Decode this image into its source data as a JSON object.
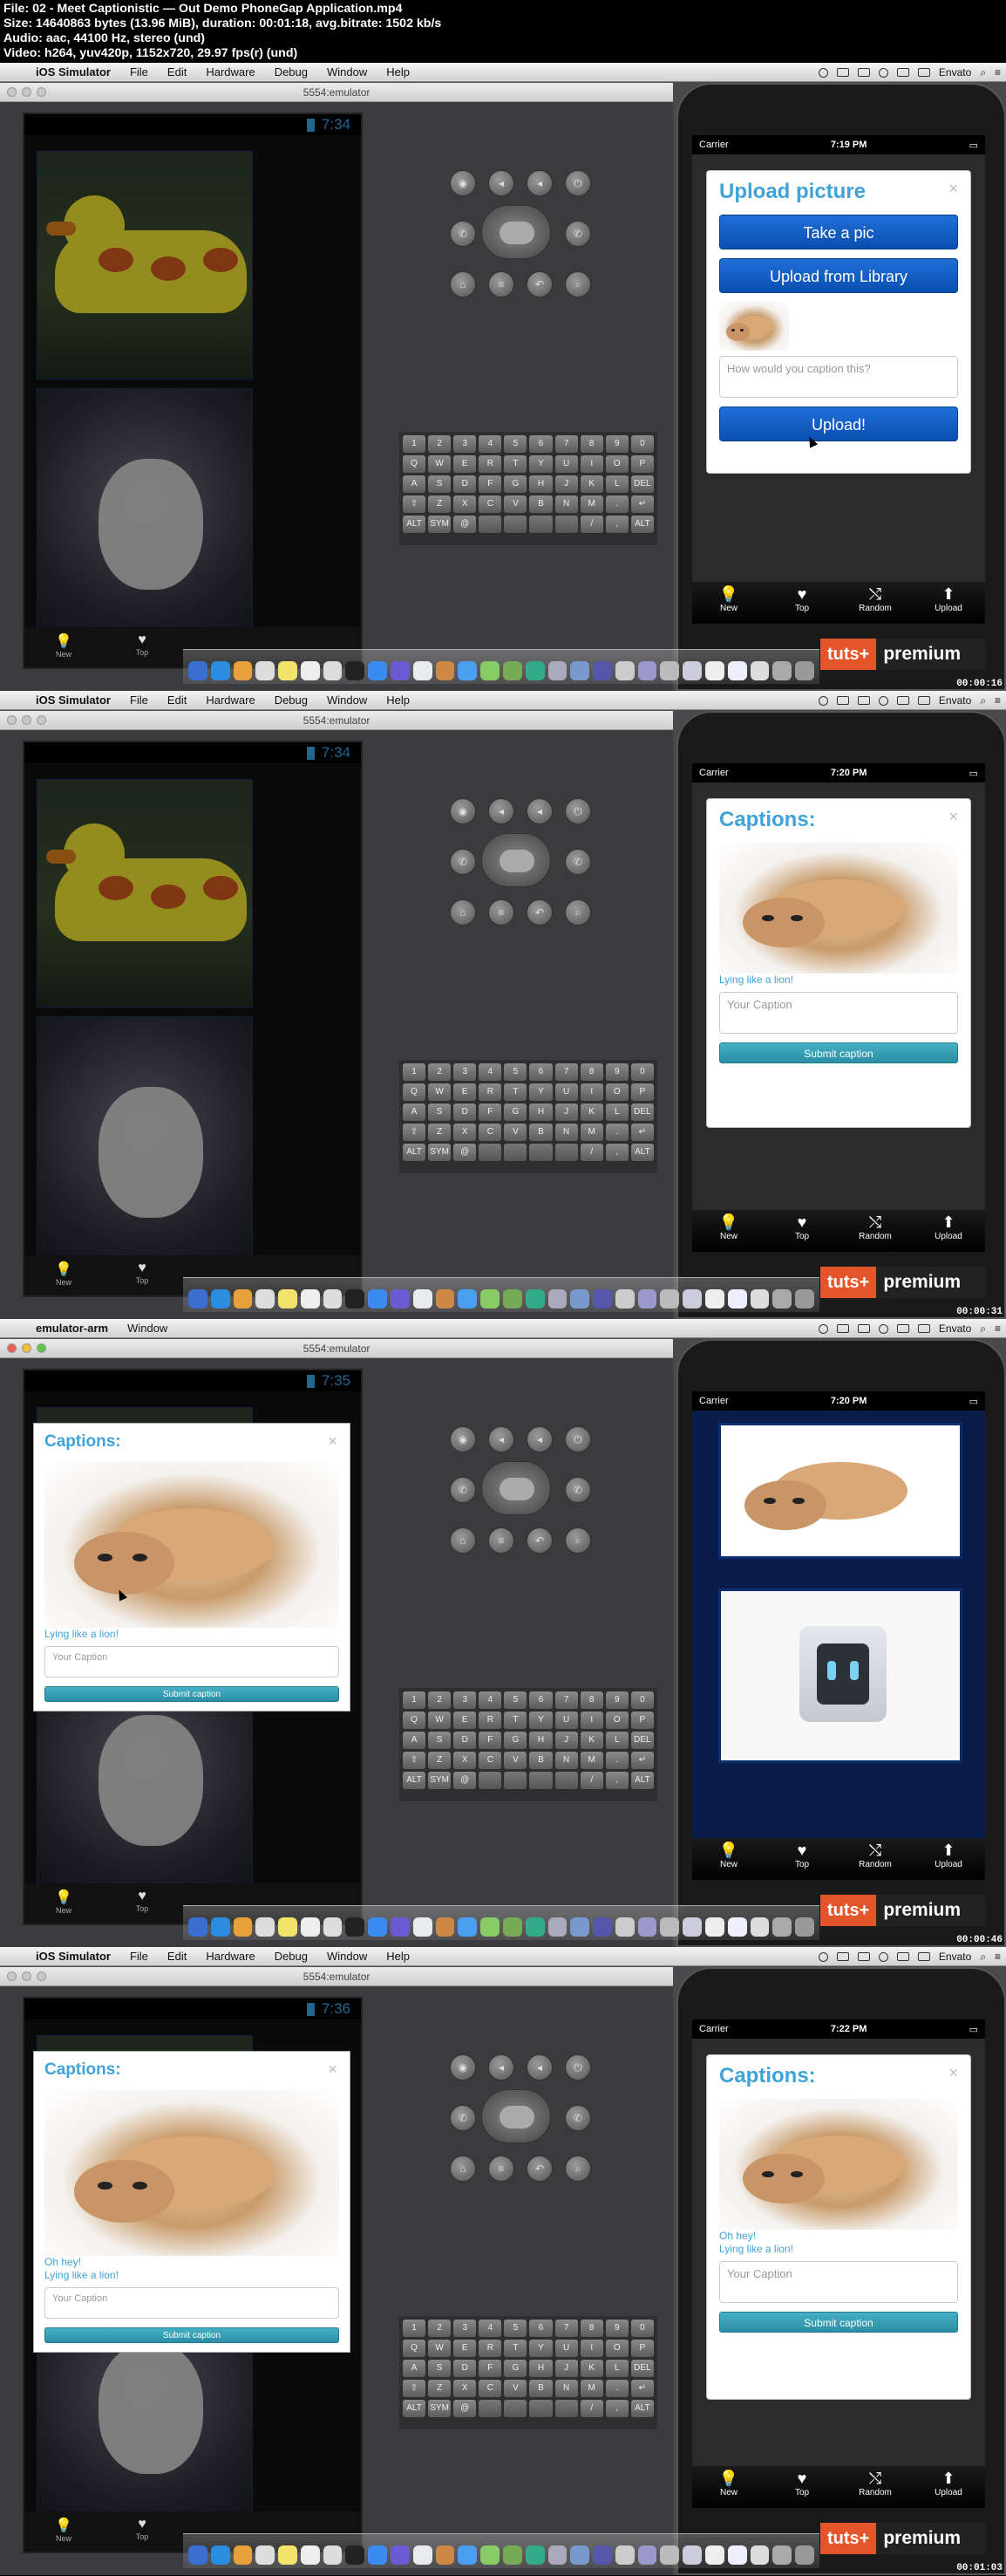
{
  "header": {
    "line1": "File: 02 - Meet Captionistic — Out Demo PhoneGap Application.mp4",
    "line2": "Size: 14640863 bytes (13.96 MiB), duration: 00:01:18, avg.bitrate: 1502 kb/s",
    "line3": "Audio: aac, 44100 Hz, stereo (und)",
    "line4": "Video: h264, yuv420p, 1152x720, 29.97 fps(r) (und)"
  },
  "emulator_window_title": "5554:emulator",
  "menu_items": [
    "File",
    "Edit",
    "Hardware",
    "Debug",
    "Window",
    "Help"
  ],
  "menu_right": "Envato",
  "keyboard_rows": [
    [
      "1",
      "2",
      "3",
      "4",
      "5",
      "6",
      "7",
      "8",
      "9",
      "0"
    ],
    [
      "Q",
      "W",
      "E",
      "R",
      "T",
      "Y",
      "U",
      "I",
      "O",
      "P"
    ],
    [
      "A",
      "S",
      "D",
      "F",
      "G",
      "H",
      "J",
      "K",
      "L",
      "DEL"
    ],
    [
      "⇧",
      "Z",
      "X",
      "C",
      "V",
      "B",
      "N",
      "M",
      ".",
      "↵"
    ],
    [
      "ALT",
      "SYM",
      "@",
      "",
      "",
      "",
      "",
      "/",
      ",",
      "ALT"
    ]
  ],
  "tabs": [
    {
      "label": "New",
      "glyph": "💡"
    },
    {
      "label": "Top",
      "glyph": "♥"
    },
    {
      "label": "Random",
      "glyph": "⤭"
    },
    {
      "label": "Upload",
      "glyph": "⬆"
    }
  ],
  "android_nav": [
    {
      "label": "New"
    },
    {
      "label": "Top"
    }
  ],
  "brand": {
    "tuts": "tuts+",
    "premium": "premium"
  },
  "frames": [
    {
      "app": "iOS Simulator",
      "android_time": "7:34",
      "ios_carrier": "Carrier",
      "ios_time": "7:19 PM",
      "timestamp": "00:00:16",
      "upload_modal": {
        "title": "Upload picture",
        "close": "×",
        "take_pic": "Take a pic",
        "upload_library": "Upload from Library",
        "caption_placeholder": "How would you caption this?",
        "upload_button": "Upload!"
      }
    },
    {
      "app": "iOS Simulator",
      "android_time": "7:34",
      "ios_carrier": "Carrier",
      "ios_time": "7:20 PM",
      "timestamp": "00:00:31",
      "captions_modal": {
        "title": "Captions:",
        "close": "×",
        "captions": [
          "Lying like a lion!"
        ],
        "placeholder": "Your Caption",
        "submit": "Submit caption"
      }
    },
    {
      "app": "emulator-arm",
      "app_menu": "Window",
      "android_time": "7:35",
      "ios_carrier": "Carrier",
      "ios_time": "7:20 PM",
      "timestamp": "00:00:46",
      "android_modal": {
        "title": "Captions:",
        "close": "×",
        "captions": [
          "Lying like a lion!"
        ],
        "placeholder": "Your Caption",
        "submit": "Submit caption"
      }
    },
    {
      "app": "iOS Simulator",
      "android_time": "7:36",
      "ios_carrier": "Carrier",
      "ios_time": "7:22 PM",
      "timestamp": "00:01:03",
      "android_modal": {
        "title": "Captions:",
        "close": "×",
        "captions": [
          "Oh hey!",
          "Lying like a lion!"
        ],
        "placeholder": "Your Caption",
        "submit": "Submit caption"
      },
      "captions_modal": {
        "title": "Captions:",
        "close": "×",
        "captions": [
          "Oh hey!",
          "Lying like a lion!"
        ],
        "placeholder": "Your Caption",
        "submit": "Submit caption"
      }
    }
  ],
  "colors": {
    "accent": "#3fa3d8",
    "brand_orange": "#e5552a",
    "ios_button": "#1f6fd8",
    "submit": "#46b0c4"
  }
}
